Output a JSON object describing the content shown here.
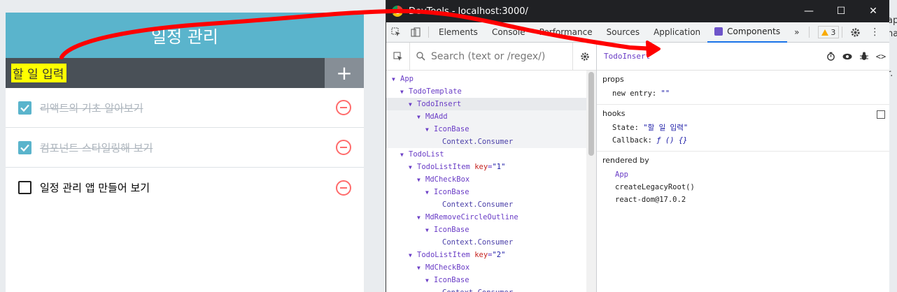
{
  "todo": {
    "title": "일정 관리",
    "input_value": "할 일 입력",
    "add_label": "+",
    "items": [
      {
        "text": "리액트의 기초 알아보기",
        "checked": true
      },
      {
        "text": "컴포넌트 스타일링해 보기",
        "checked": true
      },
      {
        "text": "일정 관리 앱 만들어 보기",
        "checked": false
      }
    ]
  },
  "background_text": [
    "ap",
    "na",
    "",
    "",
    "r."
  ],
  "devtools": {
    "window_title": "DevTools - localhost:3000/",
    "window_buttons": {
      "minimize": "—",
      "maximize": "☐",
      "close": "✕"
    },
    "tabs": [
      "Elements",
      "Console",
      "Performance",
      "Sources",
      "Application",
      "Components"
    ],
    "active_tab": "Components",
    "more_tabs": "»",
    "warning_count": "3",
    "search_placeholder": "Search (text or /regex/)",
    "tree": [
      {
        "indent": 0,
        "arrow": "▼",
        "name": "App"
      },
      {
        "indent": 1,
        "arrow": "▼",
        "name": "TodoTemplate"
      },
      {
        "indent": 2,
        "arrow": "▼",
        "name": "TodoInsert",
        "selected": true
      },
      {
        "indent": 3,
        "arrow": "▼",
        "name": "MdAdd",
        "highlighted": true
      },
      {
        "indent": 4,
        "arrow": "▼",
        "name": "IconBase",
        "highlighted": true
      },
      {
        "indent": 5,
        "arrow": "",
        "name": "Context.Consumer",
        "ctx": true,
        "highlighted": true
      },
      {
        "indent": 1,
        "arrow": "▼",
        "name": "TodoList"
      },
      {
        "indent": 2,
        "arrow": "▼",
        "name": "TodoListItem",
        "key": "key",
        "keyval": "\"1\""
      },
      {
        "indent": 3,
        "arrow": "▼",
        "name": "MdCheckBox"
      },
      {
        "indent": 4,
        "arrow": "▼",
        "name": "IconBase"
      },
      {
        "indent": 5,
        "arrow": "",
        "name": "Context.Consumer",
        "ctx": true
      },
      {
        "indent": 3,
        "arrow": "▼",
        "name": "MdRemoveCircleOutline"
      },
      {
        "indent": 4,
        "arrow": "▼",
        "name": "IconBase"
      },
      {
        "indent": 5,
        "arrow": "",
        "name": "Context.Consumer",
        "ctx": true
      },
      {
        "indent": 2,
        "arrow": "▼",
        "name": "TodoListItem",
        "key": "key",
        "keyval": "\"2\""
      },
      {
        "indent": 3,
        "arrow": "▼",
        "name": "MdCheckBox"
      },
      {
        "indent": 4,
        "arrow": "▼",
        "name": "IconBase"
      },
      {
        "indent": 5,
        "arrow": "",
        "name": "Context.Consumer",
        "ctx": true
      }
    ],
    "detail": {
      "component_name": "TodoInsert",
      "props_title": "props",
      "props": [
        {
          "key": "new entry:",
          "value": "\"\""
        }
      ],
      "hooks_title": "hooks",
      "hooks": [
        {
          "key": "State:",
          "value": "\"할 일 입력\""
        },
        {
          "key": "Callback:",
          "value": "ƒ () {}"
        }
      ],
      "rendered_by_title": "rendered by",
      "rendered_by": [
        "App",
        "createLegacyRoot()",
        "react-dom@17.0.2"
      ]
    }
  },
  "colors": {
    "todo_header": "#5ab4cc",
    "insert_bg": "#495057",
    "add_btn": "#868e96",
    "remove": "#ff6b6b",
    "annotation": "#ff0000",
    "highlight": "#ffff00"
  }
}
